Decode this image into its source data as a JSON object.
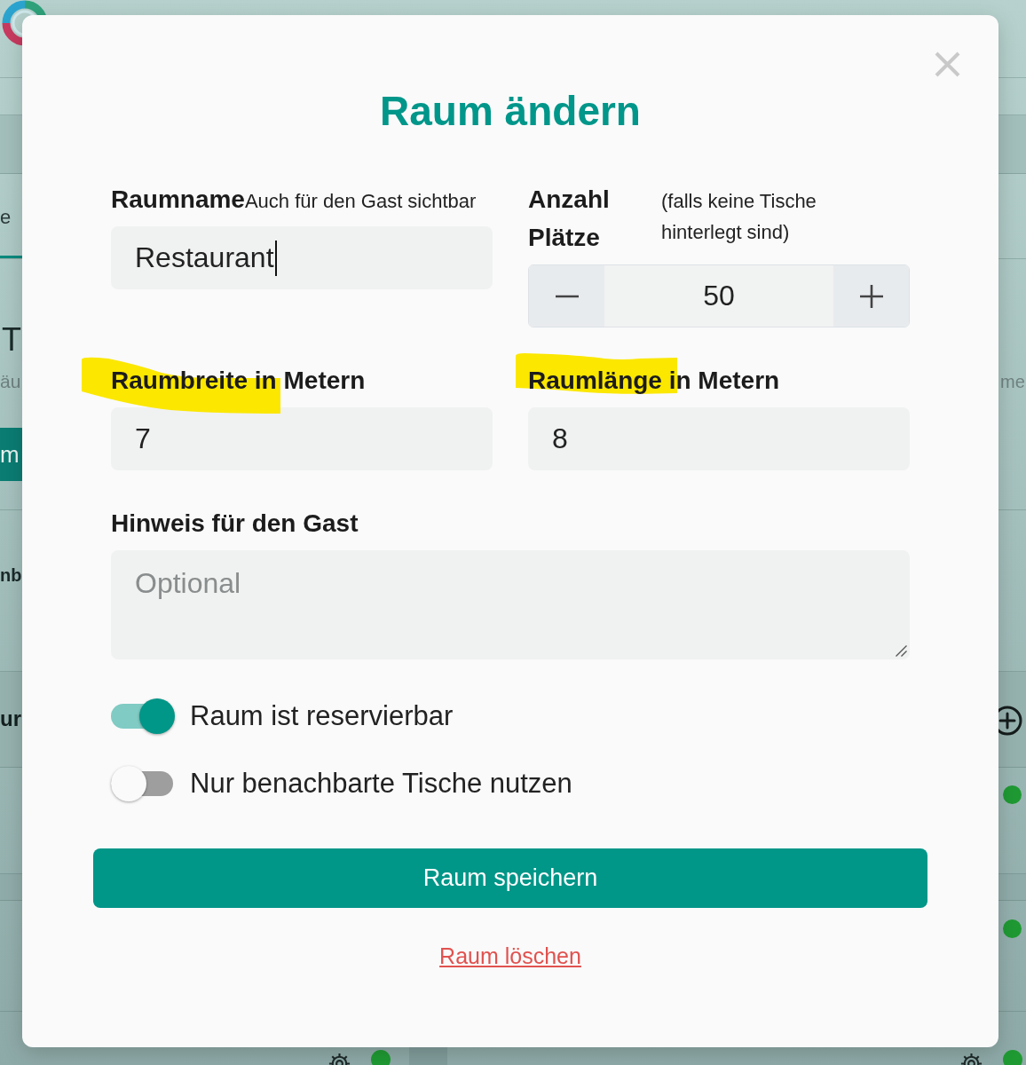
{
  "background_page": {
    "tab": {
      "label": "e",
      "selected": true
    },
    "card": {
      "heading": "T",
      "subtitle_left": "äu",
      "subtitle_right": "me",
      "button": "m"
    },
    "list_text": "nb",
    "section_title": "ur",
    "table_rows": [
      {
        "active": true
      },
      {
        "active": true
      }
    ],
    "table_cards": [
      {
        "active": true
      },
      {
        "active": true
      }
    ]
  },
  "dialog": {
    "title": "Raum ändern",
    "fields": [
      {
        "kind": "text",
        "label": "Raumname",
        "hint": "Auch für den Gast sichtbar",
        "value": "Restaurant",
        "focused": true,
        "highlighted": false
      },
      {
        "kind": "stepper",
        "label": "Anzahl Plätze",
        "hint": "(falls keine Tische hinterlegt sind)",
        "value": "50",
        "focused": false,
        "highlighted": false
      },
      {
        "kind": "text",
        "label": "Raumbreite in Metern",
        "value": "7",
        "focused": false,
        "highlighted": true
      },
      {
        "kind": "text",
        "label": "Raumlänge in Metern",
        "value": "8",
        "focused": false,
        "highlighted": true
      },
      {
        "kind": "textarea",
        "label": "Hinweis für den Gast",
        "placeholder": "Optional",
        "focused": false,
        "highlighted": false
      }
    ],
    "toggles": [
      {
        "label": "Raum ist reservierbar",
        "on": true
      },
      {
        "label": "Nur benachbarte Tische nutzen",
        "on": false
      }
    ],
    "save_button": "Raum speichern",
    "delete_link": "Raum löschen"
  }
}
